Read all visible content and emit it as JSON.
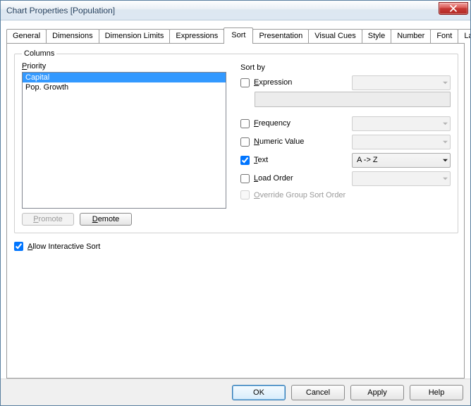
{
  "window": {
    "title": "Chart Properties [Population]"
  },
  "tabs": {
    "items": [
      "General",
      "Dimensions",
      "Dimension Limits",
      "Expressions",
      "Sort",
      "Presentation",
      "Visual Cues",
      "Style",
      "Number",
      "Font",
      "Layo"
    ],
    "active_index": 4
  },
  "columns": {
    "legend": "Columns",
    "priority_label": "Priority",
    "items": [
      "Capital",
      "Pop. Growth"
    ],
    "selected_index": 0,
    "promote_label": "Promote",
    "demote_label": "Demote"
  },
  "sortby": {
    "label": "Sort by",
    "rows": {
      "expression": {
        "label": "Expression",
        "checked": false,
        "combo": "",
        "enabled": true
      },
      "frequency": {
        "label": "Frequency",
        "checked": false,
        "combo": "",
        "enabled": true
      },
      "numeric": {
        "label": "Numeric Value",
        "checked": false,
        "combo": "",
        "enabled": true
      },
      "text": {
        "label": "Text",
        "checked": true,
        "combo": "A -> Z",
        "enabled": true
      },
      "loadorder": {
        "label": "Load Order",
        "checked": false,
        "combo": "",
        "enabled": true
      }
    },
    "override_label": "Override Group Sort Order",
    "override_checked": false,
    "override_enabled": false
  },
  "allow_interactive": {
    "label": "Allow Interactive Sort",
    "checked": true
  },
  "footer": {
    "ok": "OK",
    "cancel": "Cancel",
    "apply": "Apply",
    "help": "Help"
  }
}
